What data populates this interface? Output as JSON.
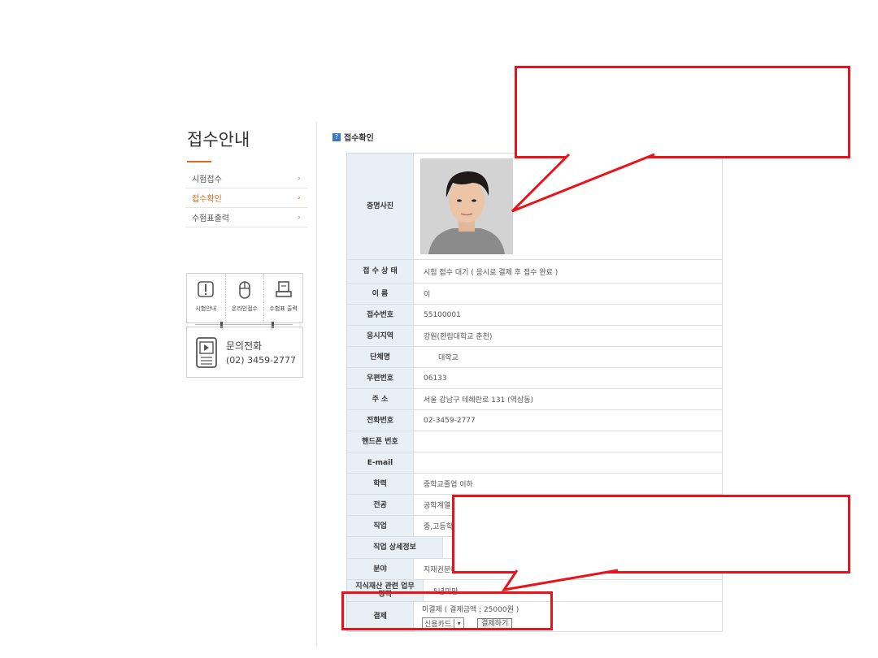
{
  "sidebar": {
    "title": "접수안내",
    "items": [
      {
        "label": "시험접수",
        "arrow": "›"
      },
      {
        "label": "접수확인",
        "arrow": "›"
      },
      {
        "label": "수험표출력",
        "arrow": "›"
      }
    ],
    "quick_links": [
      {
        "label": "시험안내",
        "icon": "exclamation-icon"
      },
      {
        "label": "온라인접수",
        "icon": "mouse-icon"
      },
      {
        "label": "수험표 출력",
        "icon": "printer-icon"
      }
    ],
    "contact": {
      "label": "문의전화",
      "phone": "(02) 3459-2777",
      "icon": "phone-icon"
    }
  },
  "section": {
    "icon_glyph": "?",
    "title": "접수확인"
  },
  "form": {
    "photo_label": "증명사진",
    "rows": [
      {
        "label": "접 수 상 태",
        "value": "시험 접수 대기 ( 응시료 결제 후 접수 완료 )"
      },
      {
        "label": "이 름",
        "value": "이"
      },
      {
        "label": "접수번호",
        "value": "55100001"
      },
      {
        "label": "응시지역",
        "value": "강원(한림대학교 춘천)"
      },
      {
        "label": "단체명",
        "value": "대학교"
      },
      {
        "label": "우편번호",
        "value": "06133"
      },
      {
        "label": "주 소",
        "value": "서울 강남구 테헤란로 131 (역삼동)"
      },
      {
        "label": "전화번호",
        "value": "02-3459-2777"
      },
      {
        "label": "핸드폰 번호",
        "value": ""
      },
      {
        "label": "E-mail",
        "value": ""
      },
      {
        "label": "학력",
        "value": "중학교졸업 이하"
      },
      {
        "label": "전공",
        "value": "공학계열"
      },
      {
        "label": "직업",
        "value": "중,고등학생"
      },
      {
        "label": "직업 상세정보",
        "value": ""
      },
      {
        "label": "분야",
        "value": "지재권분야"
      },
      {
        "label": "지식재산 관련 업무 경력",
        "value": "5년미만"
      }
    ],
    "payment": {
      "label": "결제",
      "note": "미결제 ( 결제금액 : 25000원 )",
      "method": "신용카드",
      "button": "결제하기"
    }
  },
  "colors": {
    "accent": "#d86b1f",
    "annotation": "#e8141a",
    "header_bg": "#e9f0f5"
  }
}
